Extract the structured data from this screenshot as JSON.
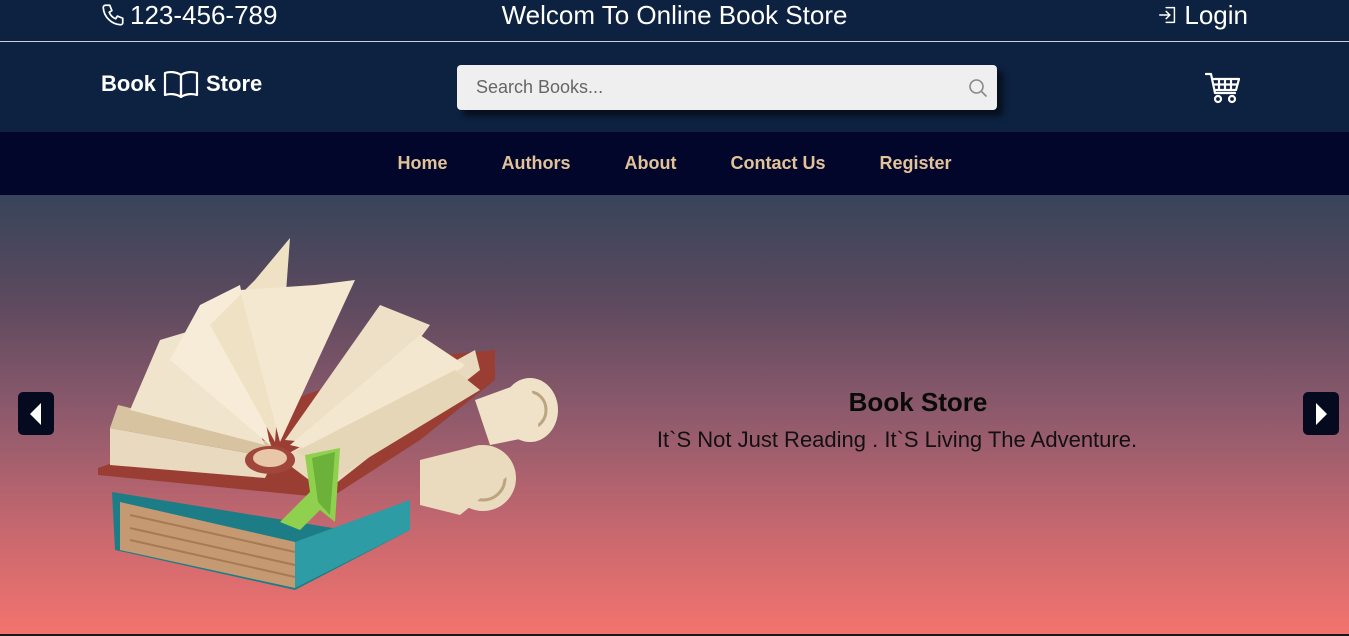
{
  "topbar": {
    "phone": "123-456-789",
    "welcome": "Welcom To Online Book Store",
    "login_label": "Login"
  },
  "header": {
    "logo_left": "Book",
    "logo_right": "Store",
    "search_placeholder": "Search Books..."
  },
  "nav": {
    "items": [
      {
        "label": "Home"
      },
      {
        "label": "Authors"
      },
      {
        "label": "About"
      },
      {
        "label": "Contact Us"
      },
      {
        "label": "Register"
      }
    ]
  },
  "hero": {
    "title": "Book Store",
    "subtitle": "It`S Not Just Reading . It`S Living The Adventure."
  },
  "icons": {
    "phone": "phone-icon",
    "login": "login-icon",
    "logo": "open-book-icon",
    "search": "search-icon",
    "cart": "cart-icon",
    "prev": "chevron-left-icon",
    "next": "chevron-right-icon"
  },
  "colors": {
    "header_bg": "#0d2140",
    "nav_bg": "#02062b",
    "nav_text": "#e2c299",
    "hero_top": "#37445a",
    "hero_bottom": "#f4736d"
  }
}
